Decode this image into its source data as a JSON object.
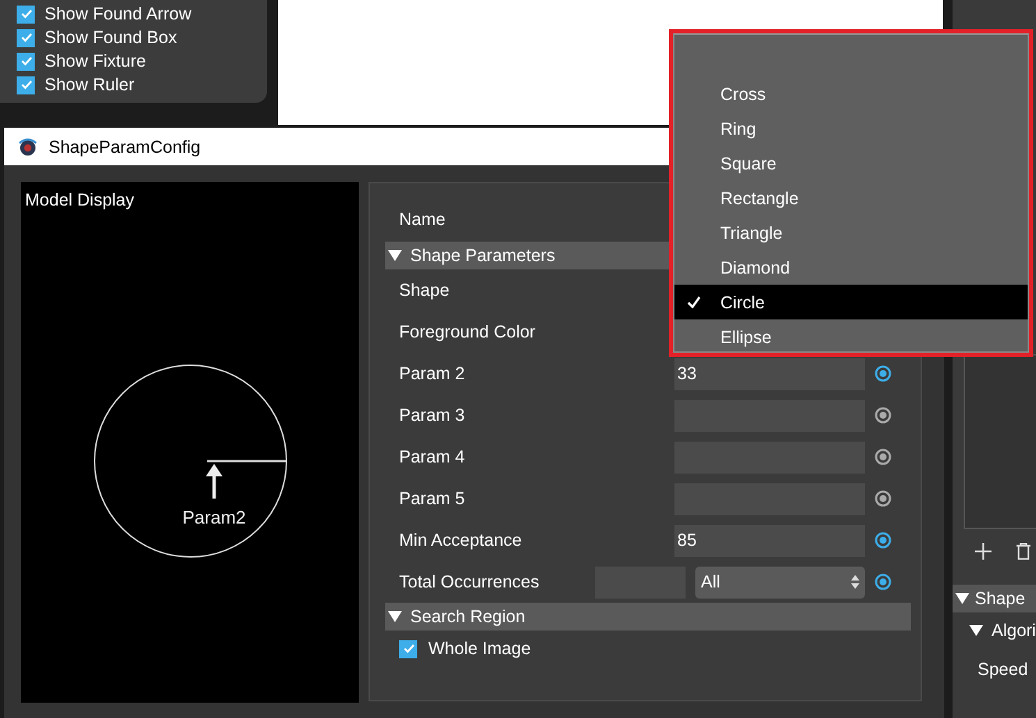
{
  "display_options": [
    {
      "label": "Show Found Arrow",
      "checked": true
    },
    {
      "label": "Show Found Box",
      "checked": true
    },
    {
      "label": "Show Fixture",
      "checked": true
    },
    {
      "label": "Show Ruler",
      "checked": true
    }
  ],
  "dialog": {
    "title": "ShapeParamConfig",
    "model_display": {
      "title": "Model Display",
      "annotation": "Param2"
    },
    "name_label": "Name",
    "sections": [
      {
        "title": "Shape Parameters",
        "expanded": true,
        "rows": [
          {
            "kind": "label",
            "label": "Shape"
          },
          {
            "kind": "label",
            "label": "Foreground Color"
          },
          {
            "kind": "field",
            "label": "Param 2",
            "value": "33",
            "active": true
          },
          {
            "kind": "field",
            "label": "Param 3",
            "active": false
          },
          {
            "kind": "field",
            "label": "Param 4",
            "active": false
          },
          {
            "kind": "field",
            "label": "Param 5",
            "active": false
          },
          {
            "kind": "field",
            "label": "Min Acceptance",
            "value": "85",
            "active": true
          },
          {
            "kind": "count",
            "label": "Total Occurrences",
            "value": "All",
            "active": true
          }
        ]
      },
      {
        "title": "Search Region",
        "expanded": true,
        "rows": [
          {
            "kind": "checkbox",
            "label": "Whole Image",
            "checked": true
          }
        ]
      }
    ]
  },
  "shape_menu": [
    {
      "label": "Cross",
      "selected": false
    },
    {
      "label": "Ring",
      "selected": false
    },
    {
      "label": "Square",
      "selected": false
    },
    {
      "label": "Rectangle",
      "selected": false
    },
    {
      "label": "Triangle",
      "selected": false
    },
    {
      "label": "Diamond",
      "selected": false
    },
    {
      "label": "Circle",
      "selected": true
    },
    {
      "label": "Ellipse",
      "selected": false
    }
  ],
  "side_panel": {
    "sections": [
      {
        "title": "Shape",
        "expanded": true
      }
    ],
    "subsections": [
      {
        "title": "Algori",
        "expanded": true
      }
    ],
    "labels": [
      "Speed"
    ]
  }
}
